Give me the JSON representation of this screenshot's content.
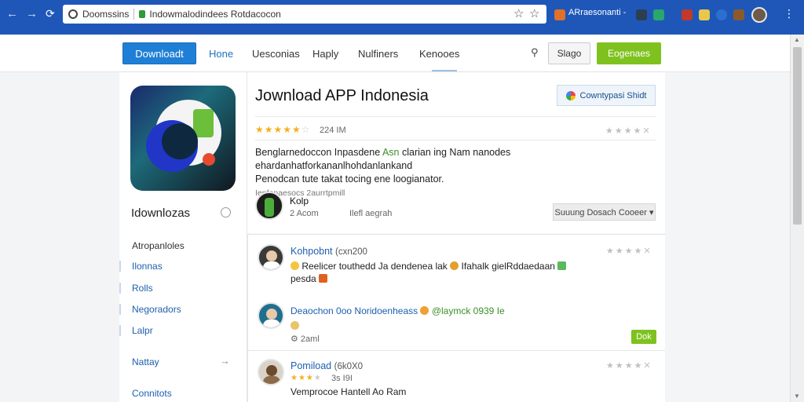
{
  "browser": {
    "address_title": "Doomssins",
    "address_url": "Indowmalodindees Rotdacocon",
    "extension_label": "ARraesonanti -",
    "back": "←",
    "forward": "→",
    "refresh": "⟳",
    "star_icon": "☆",
    "menu": "⋮"
  },
  "topnav": {
    "download_button": "Downloadt",
    "links": [
      "Hone",
      "Uesconias",
      "Haply",
      "Nulfiners",
      "Kenooes"
    ],
    "signin_button": "Slago",
    "register_button": "Eogenaes"
  },
  "sidebar": {
    "title": "Idownlozas",
    "items": [
      "Atropanloles",
      "Ilonnas",
      "Rolls",
      "Negoradors",
      "Lalpr",
      "Nattay",
      "Connitots"
    ]
  },
  "app": {
    "title": "Jownload APP Indonesia",
    "share_button": "Cowntypasi Shidt",
    "rating_count": "224 IM",
    "description_line1_a": "Benglarnedoccon Inpasdene",
    "description_line1_green": "Asn",
    "description_line1_b": "clarian ing Nam nanodes ehardanhatforkananlhohdanlankand",
    "description_line2": "Penodcan tute takat tocing ene loogianator.",
    "description_meta": "Ienfenaesocs 2aurrtpmill",
    "author_name": "Kolp",
    "author_meta1": "2 Acom",
    "author_meta2": "Ilefl aegrah",
    "author_button": "Suuung Dosach Cooeer ▾"
  },
  "reviews": [
    {
      "name": "Kohpobnt",
      "time": "(cxn200",
      "text_a": "Reelicer touthedd Ja dendenea lak",
      "text_b": "Ifahalk gielRddaedaan",
      "text_c": "pesda",
      "reply_name": "Deaochon 0oo Noridoenheass",
      "reply_tag": "@laymck 0939 Ie",
      "reply_meta": "2aml",
      "reply_button": "Dok"
    },
    {
      "name": "Pomiload",
      "time": "(6k0X0",
      "rating_text": "3s I9I",
      "text_a": "Vemprocoe Hantell Ao Ram"
    }
  ],
  "colors": {
    "chrome": "#1e57b8",
    "primary": "#1f7fd6",
    "green": "#7fc21f",
    "star": "#f2b01e"
  }
}
